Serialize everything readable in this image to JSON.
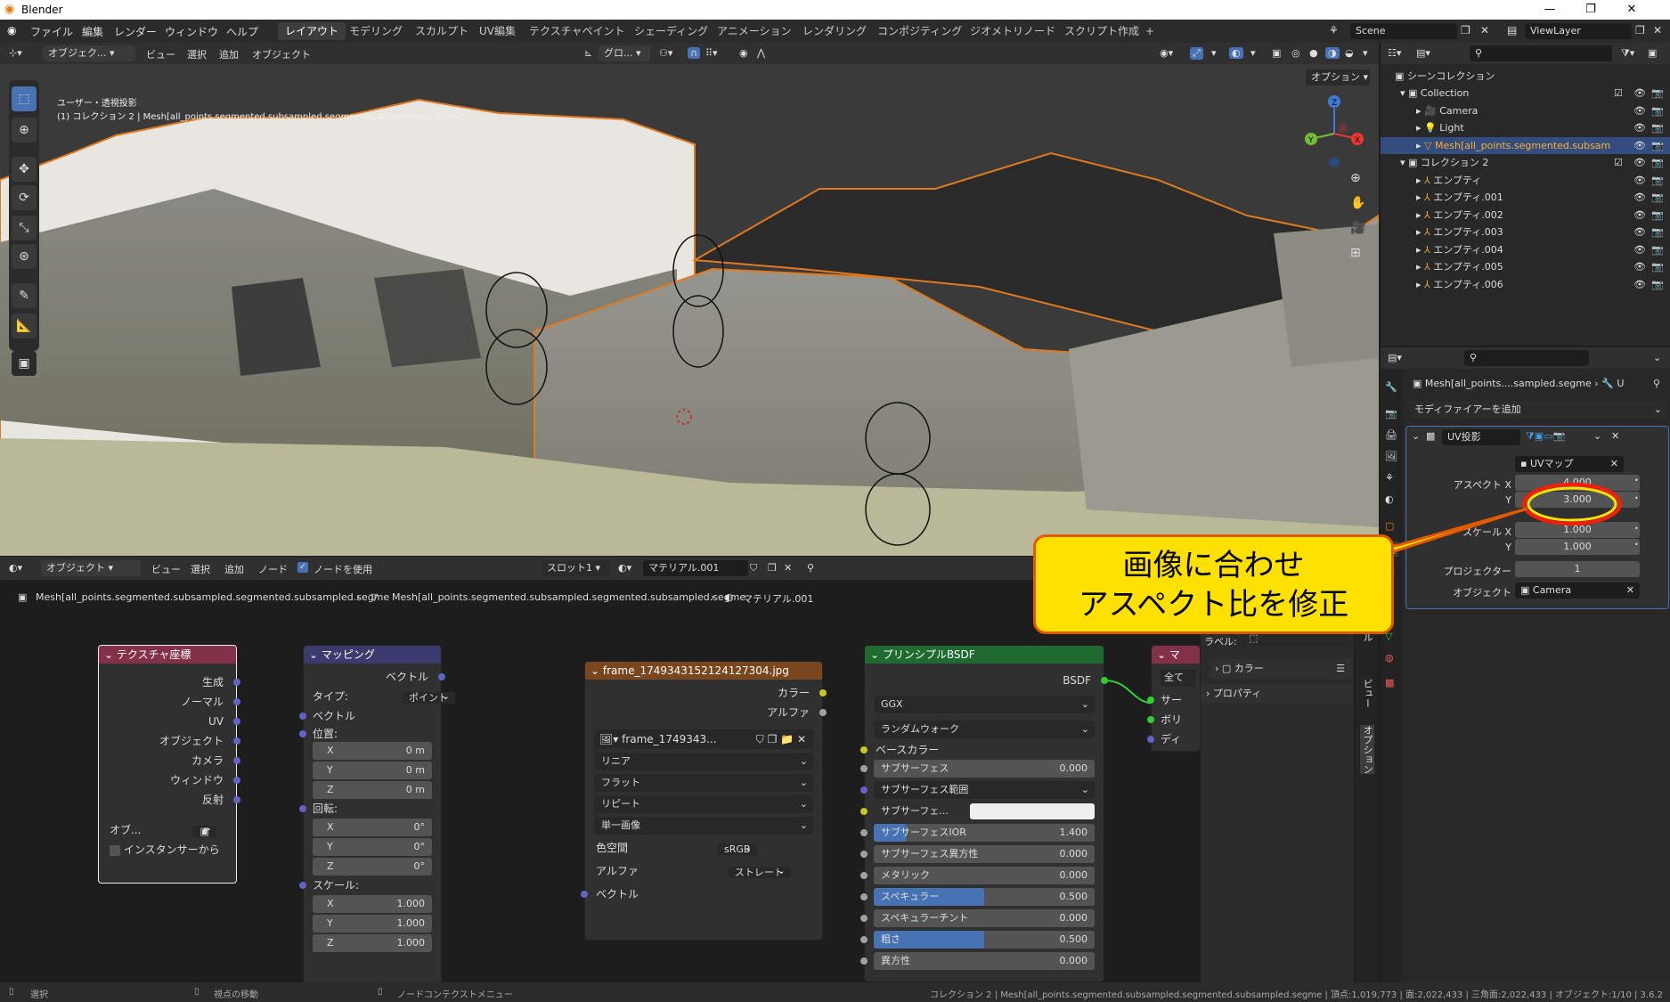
{
  "window": {
    "title": "Blender"
  },
  "menubar": {
    "items": [
      "ファイル",
      "編集",
      "レンダー",
      "ウィンドウ",
      "ヘルプ"
    ]
  },
  "workspaces": {
    "tabs": [
      "レイアウト",
      "モデリング",
      "スカルプト",
      "UV編集",
      "テクスチャペイント",
      "シェーディング",
      "アニメーション",
      "レンダリング",
      "コンポジティング",
      "ジオメトリノード",
      "スクリプト作成"
    ],
    "active": "レイアウト",
    "add": "+"
  },
  "scene": {
    "name": "Scene",
    "view_layer": "ViewLayer"
  },
  "viewport": {
    "mode": "オブジェク...",
    "menus": [
      "ビュー",
      "選択",
      "追加",
      "オブジェクト"
    ],
    "transform": "グロ...",
    "options": "オプション",
    "view_name": "ユーザー・透視投影",
    "info": "(1) コレクション 2 | Mesh[all_points.segmented.subsampled.segmented.subsampled.segme"
  },
  "node_editor": {
    "mode": "オブジェクト",
    "menus": [
      "ビュー",
      "選択",
      "追加",
      "ノード"
    ],
    "use_nodes": "ノードを使用",
    "slot": "スロット1",
    "material": "マテリアル.001",
    "breadcrumb": [
      "Mesh[all_points.segmented.subsampled.segmented.subsampled.segme",
      "Mesh[all_points.segmented.subsampled.segmented.subsampled.segme",
      "マテリアル.001"
    ]
  },
  "nodes": {
    "texcoord": {
      "title": "テクスチャ座標",
      "outputs": [
        "生成",
        "ノーマル",
        "UV",
        "オブジェクト",
        "カメラ",
        "ウィンドウ",
        "反射"
      ],
      "object_label": "オブ...",
      "instancer": "インスタンサーから"
    },
    "mapping": {
      "title": "マッピング",
      "output": "ベクトル",
      "type_label": "タイプ:",
      "type_value": "ポイント",
      "vector": "ベクトル",
      "location": "位置:",
      "loc": [
        {
          "axis": "X",
          "value": "0 m"
        },
        {
          "axis": "Y",
          "value": "0 m"
        },
        {
          "axis": "Z",
          "value": "0 m"
        }
      ],
      "rotation": "回転:",
      "rot": [
        {
          "axis": "X",
          "value": "0°"
        },
        {
          "axis": "Y",
          "value": "0°"
        },
        {
          "axis": "Z",
          "value": "0°"
        }
      ],
      "scale": "スケール:",
      "scl": [
        {
          "axis": "X",
          "value": "1.000"
        },
        {
          "axis": "Y",
          "value": "1.000"
        },
        {
          "axis": "Z",
          "value": "1.000"
        }
      ]
    },
    "image": {
      "title": "frame_1749343152124127304.jpg",
      "out_color": "カラー",
      "out_alpha": "アルファ",
      "image_name": "frame_1749343...",
      "interp": "リニア",
      "proj": "フラット",
      "ext": "リピート",
      "source": "単一画像",
      "cs_label": "色空間",
      "cs_value": "sRGB",
      "alpha_label": "アルファ",
      "alpha_value": "ストレート",
      "vector": "ベクトル"
    },
    "bsdf": {
      "title": "プリンシプルBSDF",
      "output": "BSDF",
      "distribution": "GGX",
      "subsurface_method": "ランダムウォーク",
      "base_color": "ベースカラー",
      "fields": [
        {
          "label": "サブサーフェス",
          "value": "0.000",
          "fill": 0
        },
        {
          "label": "サブサーフェス範囲",
          "value": "",
          "fill": 0
        },
        {
          "label": "サブサーフェ...",
          "value": "",
          "fill": 0
        },
        {
          "label": "サブサーフェスIOR",
          "value": "1.400",
          "fill": 0.15
        },
        {
          "label": "サブサーフェス異方性",
          "value": "0.000",
          "fill": 0
        },
        {
          "label": "メタリック",
          "value": "0.000",
          "fill": 0
        },
        {
          "label": "スペキュラー",
          "value": "0.500",
          "fill": 0.5
        },
        {
          "label": "スペキュラーチント",
          "value": "0.000",
          "fill": 0
        },
        {
          "label": "粗さ",
          "value": "0.500",
          "fill": 0.5
        },
        {
          "label": "異方性",
          "value": "0.000",
          "fill": 0
        }
      ]
    },
    "output": {
      "title": "マ",
      "all": "全て",
      "inputs": [
        "サー",
        "ボリ",
        "ディ"
      ]
    }
  },
  "sidepanel": {
    "label": "ラベル:",
    "color": "カラー",
    "properties": "プロパティ",
    "tabs": [
      "ツール",
      "ビュー",
      "オプション"
    ]
  },
  "outliner": {
    "root": "シーンコレクション",
    "rows": [
      {
        "name": "Collection",
        "depth": 1
      },
      {
        "name": "Camera",
        "depth": 2
      },
      {
        "name": "Light",
        "depth": 2
      },
      {
        "name": "Mesh[all_points.segmented.subsam",
        "depth": 2,
        "selected": true
      },
      {
        "name": "コレクション 2",
        "depth": 1
      },
      {
        "name": "エンプティ",
        "depth": 2
      },
      {
        "name": "エンプティ.001",
        "depth": 2
      },
      {
        "name": "エンプティ.002",
        "depth": 2
      },
      {
        "name": "エンプティ.003",
        "depth": 2
      },
      {
        "name": "エンプティ.004",
        "depth": 2
      },
      {
        "name": "エンプティ.005",
        "depth": 2
      },
      {
        "name": "エンプティ.006",
        "depth": 2
      }
    ]
  },
  "properties": {
    "object": "Mesh[all_points....sampled.segme",
    "sep": "U",
    "add_modifier": "モディファイアーを追加",
    "modifier_name": "UV投影",
    "uvmap_label": "UVマップ",
    "uvmap_value": "UVマップ",
    "aspect_x_label": "アスペクト X",
    "aspect_x": "4.000",
    "aspect_y_label": "Y",
    "aspect_y": "3.000",
    "scale_x_label": "スケール X",
    "scale_x": "1.000",
    "scale_y_label": "Y",
    "scale_y": "1.000",
    "projector_label": "プロジェクター",
    "projector": "1",
    "object_label": "オブジェクト",
    "object_value": "Camera"
  },
  "callout": {
    "line1": "画像に合わせ",
    "line2": "アスペクト比を修正"
  },
  "statusbar": {
    "select": "選択",
    "move": "視点の移動",
    "context": "ノードコンテクストメニュー",
    "info": "コレクション 2 | Mesh[all_points.segmented.subsampled.segmented.subsampled.segme | 頂点:1,019,773 | 面:2,022,433 | 三角面:2,022,433 | オブジェクト:1/10 | 3.6.2"
  },
  "colors": {
    "accent": "#4772b3",
    "highlight_circle": "#ff1a00",
    "callout_bg": "#ffe100",
    "node_input": "#83314a",
    "node_vector": "#3b3b6d",
    "node_texture": "#79461d",
    "node_shader": "#1e6a30"
  }
}
